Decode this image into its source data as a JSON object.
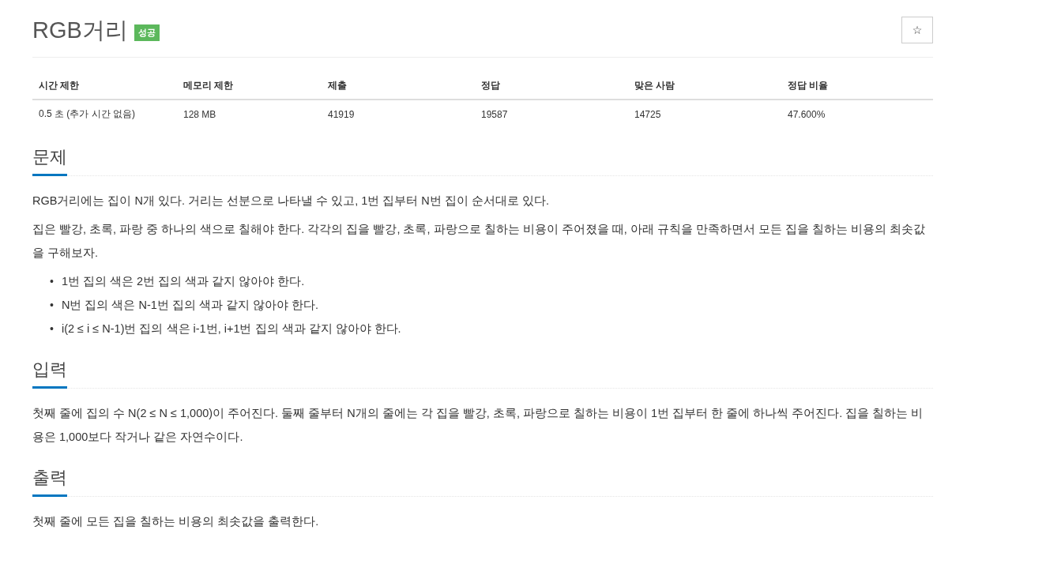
{
  "title": "RGB거리",
  "badge": "성공",
  "star_button": "☆",
  "info_table": {
    "columns": [
      "시간 제한",
      "메모리 제한",
      "제출",
      "정답",
      "맞은 사람",
      "정답 비율"
    ],
    "rows": [
      [
        "0.5 초 (추가 시간 없음)",
        "128 MB",
        "41919",
        "19587",
        "14725",
        "47.600%"
      ]
    ]
  },
  "sections": [
    {
      "heading": "문제",
      "paragraphs": [
        "RGB거리에는 집이 N개 있다. 거리는 선분으로 나타낼 수 있고, 1번 집부터 N번 집이 순서대로 있다.",
        "집은 빨강, 초록, 파랑 중 하나의 색으로 칠해야 한다. 각각의 집을 빨강, 초록, 파랑으로 칠하는 비용이 주어졌을 때, 아래 규칙을 만족하면서 모든 집을 칠하는 비용의 최솟값을 구해보자."
      ],
      "bullet": "•",
      "list": [
        "1번 집의 색은 2번 집의 색과 같지 않아야 한다.",
        "N번 집의 색은 N-1번 집의 색과 같지 않아야 한다.",
        "i(2 ≤ i ≤ N-1)번 집의 색은 i-1번, i+1번 집의 색과 같지 않아야 한다."
      ]
    },
    {
      "heading": "입력",
      "paragraphs": [
        "첫째 줄에 집의 수 N(2 ≤ N ≤ 1,000)이 주어진다. 둘째 줄부터 N개의 줄에는 각 집을 빨강, 초록, 파랑으로 칠하는 비용이 1번 집부터 한 줄에 하나씩 주어진다. 집을 칠하는 비용은 1,000보다 작거나 같은 자연수이다."
      ]
    },
    {
      "heading": "출력",
      "paragraphs": [
        "첫째 줄에 모든 집을 칠하는 비용의 최솟값을 출력한다."
      ]
    }
  ]
}
